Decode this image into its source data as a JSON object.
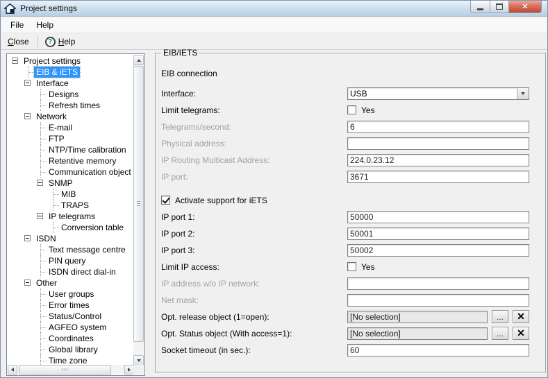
{
  "window": {
    "title": "Project settings",
    "close_glyph": "✕"
  },
  "menubar": {
    "items": [
      {
        "label": "File"
      },
      {
        "label": "Help"
      }
    ]
  },
  "toolbar": {
    "close": {
      "accel": "C",
      "rest": "lose"
    },
    "help": {
      "accel": "H",
      "rest": "elp"
    },
    "help_icon_glyph": "?"
  },
  "tree": {
    "items": [
      {
        "label": "Project settings",
        "level": 0,
        "expander": true
      },
      {
        "label": "EIB & iETS",
        "level": 1,
        "selected": true
      },
      {
        "label": "Interface",
        "level": 1,
        "expander": true
      },
      {
        "label": "Designs",
        "level": 2
      },
      {
        "label": "Refresh times",
        "level": 2
      },
      {
        "label": "Network",
        "level": 1,
        "expander": true
      },
      {
        "label": "E-mail",
        "level": 2
      },
      {
        "label": "FTP",
        "level": 2
      },
      {
        "label": "NTP/Time calibration",
        "level": 2
      },
      {
        "label": "Retentive memory",
        "level": 2
      },
      {
        "label": "Communication object gate",
        "level": 2
      },
      {
        "label": "SNMP",
        "level": 2,
        "expander": true
      },
      {
        "label": "MIB",
        "level": 3
      },
      {
        "label": "TRAPS",
        "level": 3
      },
      {
        "label": "IP telegrams",
        "level": 2,
        "expander": true
      },
      {
        "label": "Conversion table",
        "level": 3
      },
      {
        "label": "ISDN",
        "level": 1,
        "expander": true
      },
      {
        "label": "Text message centre",
        "level": 2
      },
      {
        "label": "PIN query",
        "level": 2
      },
      {
        "label": "ISDN direct dial-in",
        "level": 2
      },
      {
        "label": "Other",
        "level": 1,
        "expander": true
      },
      {
        "label": "User groups",
        "level": 2
      },
      {
        "label": "Error times",
        "level": 2
      },
      {
        "label": "Status/Control",
        "level": 2
      },
      {
        "label": "AGFEO system",
        "level": 2
      },
      {
        "label": "Coordinates",
        "level": 2
      },
      {
        "label": "Global library",
        "level": 2
      },
      {
        "label": "Time zone",
        "level": 2
      }
    ]
  },
  "form": {
    "legend": "EIB/IETS",
    "header": "EIB connection",
    "browse_label": "...",
    "clear_label": "✕",
    "rows": [
      {
        "type": "combo",
        "name": "interface",
        "label": "Interface:",
        "value": "USB"
      },
      {
        "type": "checkbox",
        "name": "limit-telegrams",
        "label": "Limit telegrams:",
        "value": "Yes",
        "checked": false
      },
      {
        "type": "text",
        "name": "telegrams-per-second",
        "label": "Telegrams/second:",
        "value": "6",
        "disabled": true
      },
      {
        "type": "text",
        "name": "physical-address",
        "label": "Physical address:",
        "value": "",
        "disabled": true
      },
      {
        "type": "text",
        "name": "ip-routing-multicast",
        "label": "IP Routing Multicast Address:",
        "value": "224.0.23.12",
        "disabled": true
      },
      {
        "type": "text",
        "name": "ip-port",
        "label": "IP port:",
        "value": "3671",
        "disabled": true
      },
      {
        "type": "checkbox-solo",
        "name": "activate-iets",
        "label": "Activate support for iETS",
        "checked": true,
        "gap_before": true
      },
      {
        "type": "text",
        "name": "ip-port-1",
        "label": "IP port 1:",
        "value": "50000"
      },
      {
        "type": "text",
        "name": "ip-port-2",
        "label": "IP port 2:",
        "value": "50001"
      },
      {
        "type": "text",
        "name": "ip-port-3",
        "label": "IP port 3:",
        "value": "50002"
      },
      {
        "type": "checkbox",
        "name": "limit-ip-access",
        "label": "Limit IP access:",
        "value": "Yes",
        "checked": false
      },
      {
        "type": "text",
        "name": "ip-address-wo-network",
        "label": "IP address w/o IP network:",
        "value": "",
        "disabled": true
      },
      {
        "type": "text",
        "name": "net-mask",
        "label": "Net mask:",
        "value": "",
        "disabled": true
      },
      {
        "type": "object",
        "name": "opt-release-object",
        "label": "Opt. release object (1=open):",
        "value": "[No selection]"
      },
      {
        "type": "object",
        "name": "opt-status-object",
        "label": "Opt. Status object (With access=1):",
        "value": "[No selection]"
      },
      {
        "type": "text",
        "name": "socket-timeout",
        "label": "Socket timeout (in sec.):",
        "value": "60"
      }
    ]
  }
}
